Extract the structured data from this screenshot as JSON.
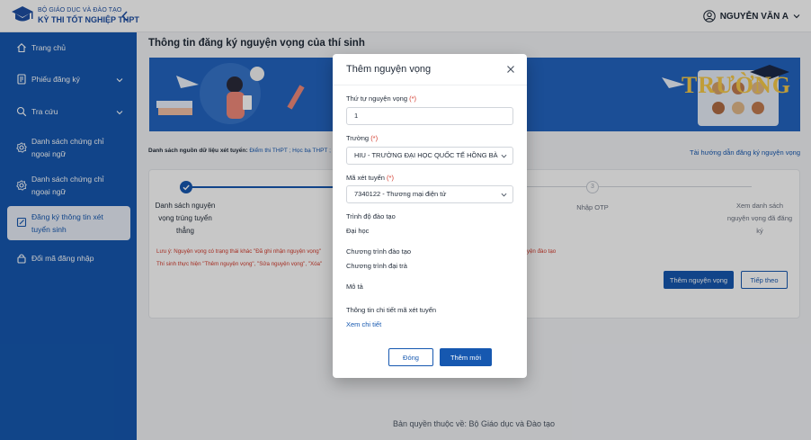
{
  "header": {
    "brand_line1": "BỘ GIÁO DỤC VÀ ĐÀO TẠO",
    "brand_line2": "KỲ THI TỐT NGHIỆP THPT",
    "user_name": "NGUYỄN VĂN A"
  },
  "sidebar": {
    "items": [
      {
        "label": "Trang chủ",
        "icon": "home-icon"
      },
      {
        "label": "Phiếu đăng ký",
        "icon": "document-icon"
      },
      {
        "label": "Tra cứu",
        "icon": "search-icon"
      },
      {
        "label": "Danh sách chứng chỉ ngoại ngữ",
        "icon": "gear-icon"
      },
      {
        "label": "Danh sách chứng chỉ ngoại ngữ",
        "icon": "gear-icon"
      },
      {
        "label": "Đăng ký thông tin xét tuyển sinh",
        "icon": "edit-icon"
      },
      {
        "label": "Đổi mã đăng nhập",
        "icon": "lock-icon"
      }
    ]
  },
  "main": {
    "page_title": "Thông tin đăng ký nguyện vọng của thí sinh",
    "banner_text": "TRƯỜNG",
    "source_prefix": "Danh sách nguồn dữ liệu xét tuyển:",
    "source_links": "Điểm thi THPT ; Học bạ THPT ;",
    "guide_link": "Tài hướng dẫn đăng ký nguyện vọng",
    "steps": {
      "step1": "Danh sách nguyện vọng trúng tuyển thẳng",
      "step3_num": "3",
      "step3": "Nhập OTP",
      "step4": "Xem danh sách nguyện vọng đã đăng ký"
    },
    "note1": "Lưu ý: Nguyện vọng có trạng thái khác \"Đã ghi nhận nguyện vọng\"",
    "note1_end": "nuyện đào tạo",
    "note2": "Thí sinh thực hiện \"Thêm nguyện vọng\", \"Sửa nguyện vọng\", \"Xóa\"",
    "add_wish_button": "Thêm nguyện vọng",
    "next_button": "Tiếp theo"
  },
  "footer": "Bản quyền thuộc về: Bộ Giáo dục và Đào tạo",
  "modal": {
    "title": "Thêm nguyện vọng",
    "order_label": "Thứ tự nguyện vọng",
    "required_mark": "(*)",
    "order_value": "1",
    "school_label": "Trường",
    "school_value": "HIU - TRƯỜNG ĐẠI HỌC QUỐC TẾ HỒNG BÀNG",
    "code_label": "Mã xét tuyển",
    "code_value": "7340122 - Thương mại điện tử",
    "level_label": "Trình độ đào tạo",
    "level_value": "Đại học",
    "program_label": "Chương trình đào tạo",
    "program_value": "Chương trình đại trà",
    "desc_label": "Mô tả",
    "detail_label": "Thông tin chi tiết mã xét tuyển",
    "detail_link": "Xem chi tiết",
    "cancel_button": "Đóng",
    "add_button": "Thêm mới"
  }
}
